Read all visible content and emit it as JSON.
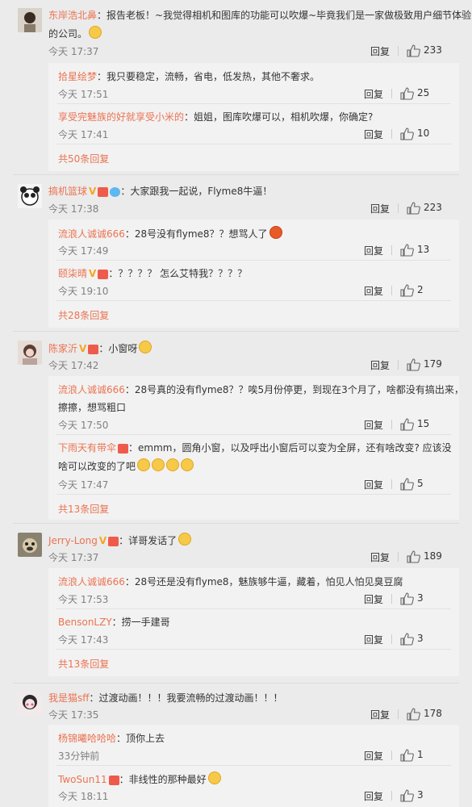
{
  "comments": [
    {
      "user": "东岸浩北鼻",
      "text_line1": "：报告老板！~我觉得相机和图库的功能可以吹爆~毕竟我们是一家做极致用户细节体验",
      "text_line2": "的公司。",
      "time": "今天 17:37",
      "reply_label": "回复",
      "likes": "233",
      "replies": [
        {
          "user": "拾星绘梦",
          "text": "：我只要稳定，流畅，省电，低发热，其他不奢求。",
          "time": "今天 17:51",
          "reply_label": "回复",
          "likes": "25"
        },
        {
          "user": "享受完魅族的好就享受小米的",
          "text": "：姐姐，图库吹爆可以，相机吹爆，你确定?",
          "time": "今天 17:41",
          "reply_label": "回复",
          "likes": "10"
        }
      ],
      "more": "共50条回复"
    },
    {
      "user": "搞机篮球",
      "text_line1": "：大家跟我一起说，Flyme8牛逼！",
      "time": "今天 17:38",
      "reply_label": "回复",
      "likes": "223",
      "replies": [
        {
          "user": "流浪人诚诚666",
          "text": "：28号没有flyme8？？想骂人了",
          "time": "今天 17:49",
          "reply_label": "回复",
          "likes": "13"
        },
        {
          "user": "颐柒晴",
          "text": "：？？？？ 怎么艾特我？？？？",
          "time": "今天 19:10",
          "reply_label": "回复",
          "likes": "2"
        }
      ],
      "more": "共28条回复"
    },
    {
      "user": "陈家沂",
      "text_line1": "：小窗呀",
      "time": "今天 17:42",
      "reply_label": "回复",
      "likes": "179",
      "replies": [
        {
          "user": "流浪人诚诚666",
          "text": "：28号真的没有flyme8？？唉5月份停更，到现在3个月了，啥都没有搞出来，",
          "text2": "擦擦，想骂粗口",
          "time": "今天 17:50",
          "reply_label": "回复",
          "likes": "15"
        },
        {
          "user": "下雨天有带伞",
          "text": "：emmm，圆角小窗，以及呼出小窗后可以变为全屏，还有啥改变? 应该没",
          "text2": "啥可以改变的了吧",
          "time": "今天 17:47",
          "reply_label": "回复",
          "likes": "5"
        }
      ],
      "more": "共13条回复"
    },
    {
      "user": "Jerry-Long",
      "text_line1": "：详哥发话了",
      "time": "今天 17:37",
      "reply_label": "回复",
      "likes": "189",
      "replies": [
        {
          "user": "流浪人诚诚666",
          "text": "：28号还是没有flyme8，魅族够牛逼，藏着，怕见人怕见臭豆腐",
          "time": "今天 17:53",
          "reply_label": "回复",
          "likes": "3"
        },
        {
          "user": "BensonLZY",
          "text": "：捞一手建哥",
          "time": "今天 17:43",
          "reply_label": "回复",
          "likes": "3"
        }
      ],
      "more": "共13条回复"
    },
    {
      "user": "我是猫sff",
      "text_line1": "：过渡动画！！！我要流畅的过渡动画！！！",
      "time": "今天 17:35",
      "reply_label": "回复",
      "likes": "178",
      "replies": [
        {
          "user": "杨锦曦哈哈哈",
          "text": "：顶你上去",
          "time": "33分钟前",
          "reply_label": "回复",
          "likes": "1"
        },
        {
          "user": "TwoSun11",
          "text": "：非线性的那种最好",
          "time": "今天 18:11",
          "reply_label": "回复",
          "likes": "3"
        }
      ]
    }
  ],
  "colors": {
    "username": "#eb7350",
    "text": "#333333",
    "meta": "#808080",
    "sub_bg": "#f2f2f2"
  }
}
